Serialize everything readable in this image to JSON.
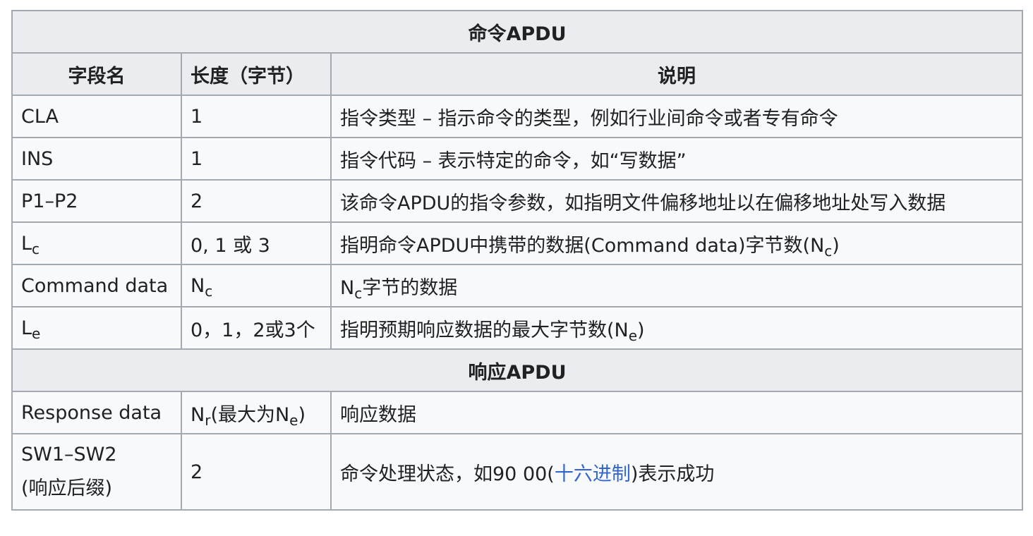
{
  "table": {
    "command_section_title": "命令APDU",
    "headers": {
      "field": "字段名",
      "length": "长度（字节）",
      "description": "说明"
    },
    "command_rows": [
      {
        "field": "CLA",
        "length": "1",
        "description": "指令类型 – 指示命令的类型，例如行业间命令或者专有命令"
      },
      {
        "field": "INS",
        "length": "1",
        "description": "指令代码 – 表示特定的命令，如“写数据”"
      },
      {
        "field": "P1–P2",
        "length": "2",
        "description": "该命令APDU的指令参数，如指明文件偏移地址以在偏移地址处写入数据"
      },
      {
        "field_main": "L",
        "field_sub": "c",
        "length": "0, 1 或 3",
        "description_main": "指明命令APDU中携带的数据(Command data)字节数(N",
        "description_sub": "c",
        "description_tail": ")"
      },
      {
        "field": "Command data",
        "length_main": "N",
        "length_sub": "c",
        "description_main": "N",
        "description_sub": "c",
        "description_tail": "字节的数据"
      },
      {
        "field_main": "L",
        "field_sub": "e",
        "length": "0，1，2或3个",
        "description_main": "指明预期响应数据的最大字节数(N",
        "description_sub": "e",
        "description_tail": ")"
      }
    ],
    "response_section_title": "响应APDU",
    "response_rows": [
      {
        "field": "Response data",
        "length_main": "N",
        "length_sub": "r",
        "length_mid": "(最大为N",
        "length_sub2": "e",
        "length_tail": ")",
        "description": "响应数据"
      },
      {
        "field_line1": "SW1–SW2",
        "field_line2": "(响应后缀)",
        "length": "2",
        "description_pre": "命令处理状态，如90 00(",
        "description_link": "十六进制",
        "description_post": ")表示成功"
      }
    ]
  }
}
